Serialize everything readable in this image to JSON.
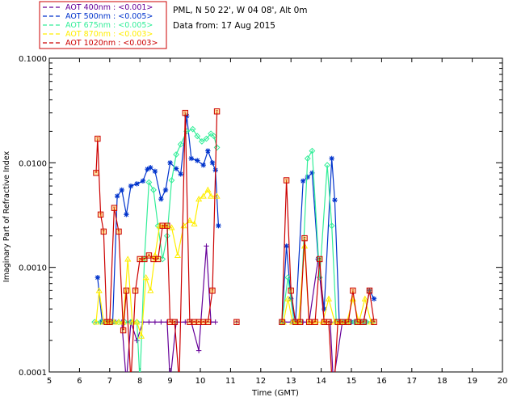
{
  "header": {
    "station": "PML, N 50 22', W 04 08', Alt 0m",
    "date": "Data from: 17 Aug 2015"
  },
  "colors": {
    "background": "#ffffff",
    "axis": "#000000",
    "legend_border": "#cc0000"
  },
  "chart_data": {
    "type": "line",
    "title": "",
    "xlabel": "Time (GMT)",
    "ylabel": "Imaginary Part of Refractive Index",
    "xlim": [
      5,
      20
    ],
    "ylim": [
      0.0001,
      0.1
    ],
    "yscale": "log",
    "grid": false,
    "legend_position": "top-left",
    "x_ticks": [
      5,
      6,
      7,
      8,
      9,
      10,
      11,
      12,
      13,
      14,
      15,
      16,
      17,
      18,
      19,
      20
    ],
    "x_tick_labels": [
      "5",
      "6",
      "7",
      "8",
      "9",
      "10",
      "11",
      "12",
      "13",
      "14",
      "15",
      "16",
      "17",
      "18",
      "19",
      "20"
    ],
    "y_ticks": [
      0.0001,
      0.001,
      0.01,
      0.1
    ],
    "y_tick_labels": [
      "0.0001",
      "0.0010",
      "0.0100",
      "0.1000"
    ],
    "series": [
      {
        "name": "AOT  400nm : <0.001>",
        "color": "#660099",
        "marker": "plus",
        "segments": [
          [
            [
              6.55,
              0.0003
            ],
            [
              6.7,
              0.0003
            ],
            [
              6.85,
              0.0003
            ],
            [
              7.0,
              0.0003
            ],
            [
              7.2,
              0.0003
            ],
            [
              7.4,
              0.0003
            ],
            [
              7.55,
              8e-05
            ],
            [
              7.7,
              0.0003
            ],
            [
              7.9,
              0.0002
            ],
            [
              8.1,
              0.0003
            ],
            [
              8.3,
              0.0003
            ],
            [
              8.5,
              0.0003
            ],
            [
              8.7,
              0.0003
            ],
            [
              8.9,
              0.0003
            ],
            [
              9.0,
              8e-05
            ],
            [
              9.2,
              0.0003
            ],
            [
              9.5,
              0.0003
            ],
            [
              9.7,
              0.0003
            ],
            [
              9.95,
              0.00016
            ],
            [
              10.2,
              0.0016
            ],
            [
              10.35,
              0.0003
            ],
            [
              10.5,
              0.0003
            ]
          ],
          [
            [
              11.2,
              0.0003
            ]
          ],
          [
            [
              12.8,
              0.0003
            ],
            [
              13.0,
              0.0003
            ],
            [
              13.2,
              0.0003
            ],
            [
              13.4,
              0.0003
            ],
            [
              13.6,
              0.0003
            ],
            [
              13.9,
              0.0012
            ],
            [
              14.1,
              0.0003
            ],
            [
              14.3,
              0.0003
            ],
            [
              14.4,
              8e-05
            ],
            [
              14.7,
              0.0003
            ],
            [
              14.9,
              0.0003
            ],
            [
              15.1,
              0.0003
            ],
            [
              15.3,
              0.0003
            ],
            [
              15.5,
              0.0003
            ],
            [
              15.7,
              0.0003
            ]
          ]
        ]
      },
      {
        "name": "AOT  500nm : <0.005>",
        "color": "#0033cc",
        "marker": "asterisk",
        "segments": [
          [
            [
              6.6,
              0.0008
            ],
            [
              6.75,
              0.0003
            ],
            [
              6.95,
              0.0003
            ],
            [
              7.1,
              0.0003
            ],
            [
              7.25,
              0.0048
            ],
            [
              7.4,
              0.0055
            ],
            [
              7.55,
              0.0032
            ],
            [
              7.7,
              0.006
            ],
            [
              7.9,
              0.0063
            ],
            [
              8.1,
              0.0067
            ],
            [
              8.25,
              0.0087
            ],
            [
              8.35,
              0.009
            ],
            [
              8.5,
              0.0083
            ],
            [
              8.7,
              0.0045
            ],
            [
              8.85,
              0.0055
            ],
            [
              9.0,
              0.01
            ],
            [
              9.2,
              0.0088
            ],
            [
              9.35,
              0.0078
            ],
            [
              9.55,
              0.028
            ],
            [
              9.7,
              0.011
            ],
            [
              9.9,
              0.0105
            ],
            [
              10.1,
              0.0095
            ],
            [
              10.25,
              0.013
            ],
            [
              10.4,
              0.01
            ],
            [
              10.5,
              0.0085
            ],
            [
              10.6,
              0.0025
            ]
          ],
          [
            [
              12.7,
              0.0003
            ],
            [
              12.85,
              0.0016
            ],
            [
              13.0,
              0.0005
            ],
            [
              13.15,
              0.0003
            ],
            [
              13.4,
              0.0067
            ],
            [
              13.55,
              0.0073
            ],
            [
              13.7,
              0.008
            ],
            [
              13.9,
              0.0012
            ],
            [
              14.1,
              0.0004
            ],
            [
              14.35,
              0.011
            ],
            [
              14.45,
              0.0044
            ],
            [
              14.6,
              0.0003
            ],
            [
              14.8,
              0.0003
            ],
            [
              15.0,
              0.0003
            ],
            [
              15.2,
              0.0003
            ],
            [
              15.4,
              0.0003
            ],
            [
              15.6,
              0.0006
            ],
            [
              15.75,
              0.0005
            ]
          ]
        ]
      },
      {
        "name": "AOT  675nm : <0.005>",
        "color": "#33ee99",
        "marker": "diamond",
        "segments": [
          [
            [
              6.5,
              0.0003
            ],
            [
              6.7,
              0.0003
            ],
            [
              6.9,
              0.0003
            ],
            [
              7.1,
              0.0003
            ],
            [
              7.3,
              0.0003
            ],
            [
              7.5,
              0.0003
            ],
            [
              7.7,
              0.0003
            ],
            [
              7.9,
              0.0003
            ],
            [
              8.0,
              8e-05
            ],
            [
              8.15,
              0.0012
            ],
            [
              8.3,
              0.0065
            ],
            [
              8.45,
              0.0055
            ],
            [
              8.6,
              0.0025
            ],
            [
              8.75,
              0.0012
            ],
            [
              8.9,
              0.002
            ],
            [
              9.05,
              0.0068
            ],
            [
              9.2,
              0.012
            ],
            [
              9.35,
              0.015
            ],
            [
              9.55,
              0.02
            ],
            [
              9.75,
              0.021
            ],
            [
              9.9,
              0.018
            ],
            [
              10.05,
              0.016
            ],
            [
              10.2,
              0.017
            ],
            [
              10.35,
              0.019
            ],
            [
              10.45,
              0.018
            ],
            [
              10.55,
              0.014
            ]
          ],
          [
            [
              12.7,
              0.0003
            ],
            [
              12.9,
              0.0008
            ],
            [
              13.1,
              0.0003
            ],
            [
              13.3,
              0.0003
            ],
            [
              13.55,
              0.011
            ],
            [
              13.7,
              0.013
            ],
            [
              13.95,
              0.0008
            ],
            [
              14.2,
              0.0095
            ],
            [
              14.35,
              0.0025
            ],
            [
              14.5,
              0.0003
            ],
            [
              14.7,
              0.0003
            ],
            [
              14.9,
              0.0003
            ],
            [
              15.1,
              0.0003
            ],
            [
              15.3,
              0.0003
            ],
            [
              15.5,
              0.0003
            ],
            [
              15.7,
              0.0003
            ]
          ]
        ]
      },
      {
        "name": "AOT  870nm : <0.003>",
        "color": "#ffee00",
        "marker": "triangle",
        "segments": [
          [
            [
              6.55,
              0.0003
            ],
            [
              6.65,
              0.0006
            ],
            [
              6.8,
              0.0003
            ],
            [
              7.0,
              0.0003
            ],
            [
              7.15,
              0.0003
            ],
            [
              7.3,
              0.0003
            ],
            [
              7.45,
              0.0003
            ],
            [
              7.6,
              0.0012
            ],
            [
              7.75,
              0.0003
            ],
            [
              7.9,
              0.0003
            ],
            [
              8.05,
              0.00022
            ],
            [
              8.2,
              0.0008
            ],
            [
              8.35,
              0.0006
            ],
            [
              8.5,
              0.0013
            ],
            [
              8.65,
              0.0025
            ],
            [
              8.85,
              0.0025
            ],
            [
              9.05,
              0.0024
            ],
            [
              9.25,
              0.0013
            ],
            [
              9.45,
              0.0025
            ],
            [
              9.65,
              0.0028
            ],
            [
              9.8,
              0.0026
            ],
            [
              9.95,
              0.0045
            ],
            [
              10.1,
              0.0048
            ],
            [
              10.25,
              0.0055
            ],
            [
              10.35,
              0.0048
            ],
            [
              10.55,
              0.0048
            ]
          ],
          [
            [
              12.75,
              0.0003
            ],
            [
              12.9,
              0.0005
            ],
            [
              13.05,
              0.0003
            ],
            [
              13.25,
              0.0003
            ],
            [
              13.45,
              0.0016
            ],
            [
              13.6,
              0.0003
            ],
            [
              13.8,
              0.0003
            ],
            [
              14.05,
              0.0003
            ],
            [
              14.25,
              0.0005
            ],
            [
              14.45,
              0.0003
            ],
            [
              14.65,
              0.0003
            ],
            [
              14.85,
              0.0003
            ],
            [
              15.05,
              0.0005
            ],
            [
              15.25,
              0.0003
            ],
            [
              15.45,
              0.0005
            ],
            [
              15.65,
              0.0003
            ]
          ]
        ]
      },
      {
        "name": "AOT 1020nm : <0.003>",
        "color": "#cc0000",
        "marker": "square",
        "segments": [
          [
            [
              6.55,
              0.008
            ],
            [
              6.6,
              0.017
            ],
            [
              6.7,
              0.0032
            ],
            [
              6.8,
              0.0022
            ],
            [
              6.9,
              0.0003
            ],
            [
              7.0,
              0.0003
            ],
            [
              7.15,
              0.0037
            ],
            [
              7.3,
              0.0022
            ],
            [
              7.45,
              0.00025
            ],
            [
              7.55,
              0.0006
            ],
            [
              7.7,
              8e-05
            ],
            [
              7.85,
              0.0006
            ],
            [
              8.0,
              0.0012
            ],
            [
              8.15,
              0.0012
            ],
            [
              8.3,
              0.0013
            ],
            [
              8.45,
              0.0012
            ],
            [
              8.6,
              0.0012
            ],
            [
              8.75,
              0.0025
            ],
            [
              8.9,
              0.0025
            ],
            [
              9.0,
              0.0003
            ],
            [
              9.15,
              0.0003
            ],
            [
              9.3,
              8e-05
            ],
            [
              9.5,
              0.03
            ],
            [
              9.65,
              0.0003
            ],
            [
              9.8,
              0.0003
            ],
            [
              9.95,
              0.0003
            ],
            [
              10.1,
              0.0003
            ],
            [
              10.25,
              0.0003
            ],
            [
              10.4,
              0.0006
            ],
            [
              10.55,
              0.031
            ]
          ],
          [
            [
              11.2,
              0.0003
            ]
          ],
          [
            [
              12.7,
              0.0003
            ],
            [
              12.85,
              0.0068
            ],
            [
              13.0,
              0.0006
            ],
            [
              13.15,
              0.0003
            ],
            [
              13.3,
              0.0003
            ],
            [
              13.45,
              0.0019
            ],
            [
              13.6,
              0.0003
            ],
            [
              13.8,
              0.0003
            ],
            [
              13.95,
              0.0012
            ],
            [
              14.1,
              0.0003
            ],
            [
              14.25,
              0.0003
            ],
            [
              14.4,
              5e-05
            ],
            [
              14.55,
              0.0003
            ],
            [
              14.7,
              0.0003
            ],
            [
              14.9,
              0.0003
            ],
            [
              15.05,
              0.0006
            ],
            [
              15.2,
              0.0003
            ],
            [
              15.4,
              0.0003
            ],
            [
              15.6,
              0.0006
            ],
            [
              15.75,
              0.0003
            ]
          ]
        ]
      }
    ]
  }
}
